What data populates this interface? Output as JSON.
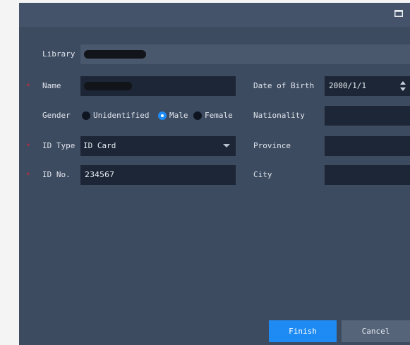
{
  "form": {
    "library_label": "Library",
    "name_label": "Name",
    "gender_label": "Gender",
    "gender_options": [
      "Unidentified",
      "Male",
      "Female"
    ],
    "gender_selected": "Male",
    "id_type_label": "ID Type",
    "id_type_value": "ID Card",
    "id_no_label": "ID No.",
    "id_no_value": "234567",
    "dob_label": "Date of Birth",
    "dob_value": "2000/1/1",
    "nationality_label": "Nationality",
    "nationality_value": "",
    "province_label": "Province",
    "province_value": "",
    "city_label": "City",
    "city_value": ""
  },
  "footer": {
    "finish_label": "Finish",
    "cancel_label": "Cancel"
  },
  "colors": {
    "dialog_bg": "#3d4b61",
    "field_bg": "#1d2636",
    "accent": "#1d8bf3",
    "required": "#d8263a"
  },
  "icons": {
    "maximize": "maximize-icon",
    "required": "asterisk-icon"
  }
}
